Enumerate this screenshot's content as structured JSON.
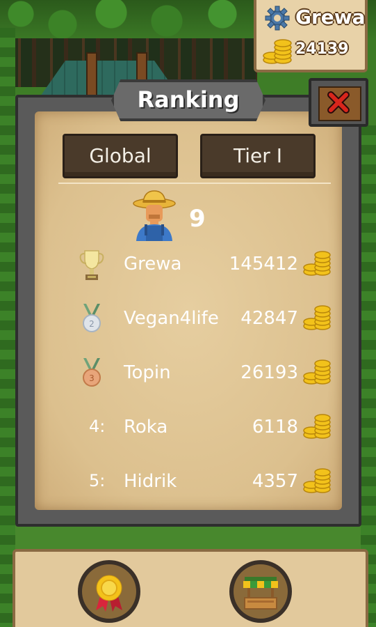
{
  "user": {
    "name": "Grewa",
    "coins": "24139"
  },
  "header": {
    "title": "Ranking"
  },
  "tabs": [
    {
      "label": "Global"
    },
    {
      "label": "Tier I"
    }
  ],
  "player": {
    "rank": "9"
  },
  "ranking": [
    {
      "rank": "",
      "icon": "trophy-icon",
      "name": "Grewa",
      "score": "145412"
    },
    {
      "rank": "",
      "icon": "silver-medal-icon",
      "medal_number": "2",
      "name": "Vegan4life",
      "score": "42847"
    },
    {
      "rank": "",
      "icon": "bronze-medal-icon",
      "medal_number": "3",
      "name": "Topin",
      "score": "26193"
    },
    {
      "rank": "4:",
      "icon": "",
      "name": "Roka",
      "score": "6118"
    },
    {
      "rank": "5:",
      "icon": "",
      "name": "Hidrik",
      "score": "4357"
    }
  ],
  "bottom_nav": [
    {
      "icon": "award-ribbon-icon"
    },
    {
      "icon": "shop-stall-icon"
    }
  ],
  "colors": {
    "parchment": "#dcc08e",
    "coin": "#f2c21b",
    "close_x": "#d8261c"
  }
}
